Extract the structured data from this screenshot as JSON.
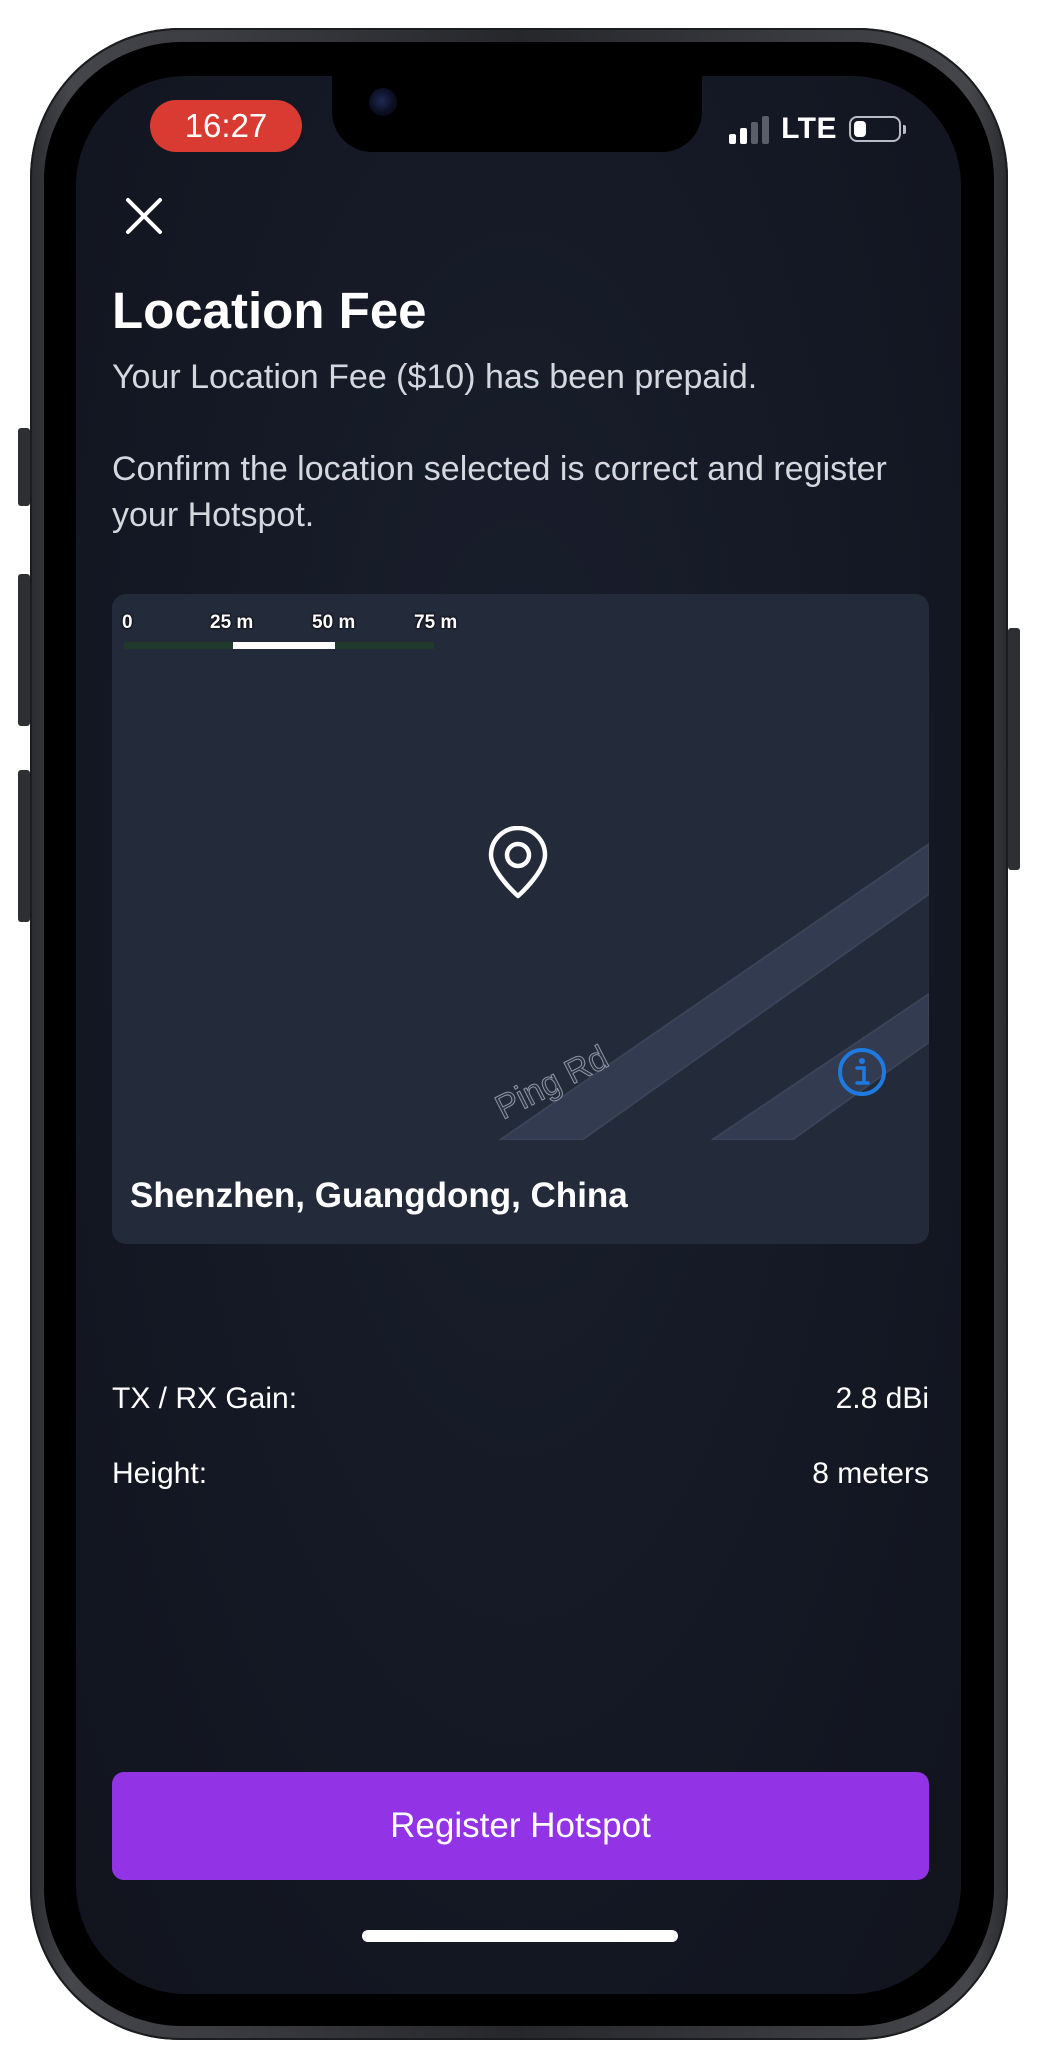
{
  "status_bar": {
    "time": "16:27",
    "network": "LTE",
    "icons": [
      "signal-icon",
      "battery-icon"
    ]
  },
  "header": {
    "close_icon": "close-icon",
    "title": "Location Fee",
    "subtitle": "Your Location Fee ($10) has been prepaid.",
    "description": "Confirm the location selected is correct and register your Hotspot."
  },
  "map": {
    "scale_labels": [
      "0",
      "25 m",
      "50 m",
      "75 m"
    ],
    "road_name": "Ping Rd",
    "pin_icon": "location-pin-icon",
    "info_icon": "info-icon",
    "location_name": "Shenzhen, Guangdong, China"
  },
  "details": [
    {
      "label": "TX / RX Gain:",
      "value": "2.8 dBi"
    },
    {
      "label": "Height:",
      "value": "8 meters"
    }
  ],
  "actions": {
    "register_label": "Register Hotspot"
  },
  "colors": {
    "accent": "#9333e6",
    "background": "#141824",
    "card": "#232a3a",
    "info": "#1f7ae0",
    "time_pill": "#d93b32"
  }
}
